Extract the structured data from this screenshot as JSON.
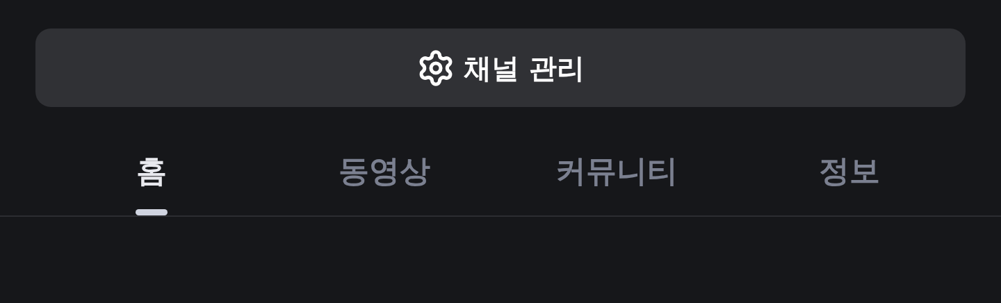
{
  "manage_button": {
    "label": "채널 관리"
  },
  "tabs": [
    {
      "label": "홈",
      "selected": true
    },
    {
      "label": "동영상",
      "selected": false
    },
    {
      "label": "커뮤니티",
      "selected": false
    },
    {
      "label": "정보",
      "selected": false
    }
  ]
}
